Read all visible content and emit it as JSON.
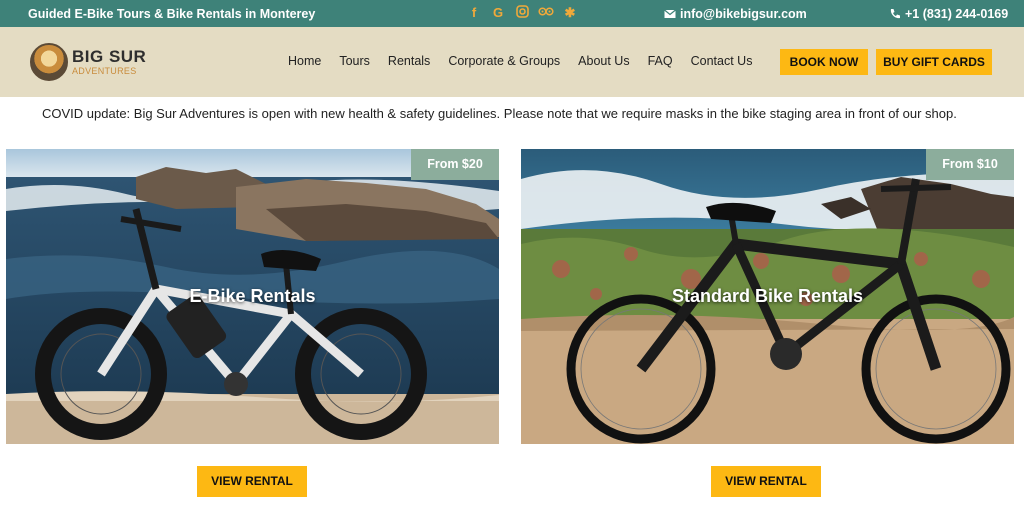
{
  "topbar": {
    "tagline": "Guided E-Bike Tours & Bike Rentals in Monterey",
    "email": "info@bikebigsur.com",
    "phone": "+1 (831) 244-0169",
    "social_icons": [
      "facebook-icon",
      "google-icon",
      "instagram-icon",
      "tripadvisor-icon",
      "yelp-icon"
    ]
  },
  "logo": {
    "line1": "BIG SUR",
    "line2": "ADVENTURES"
  },
  "nav": {
    "items": [
      "Home",
      "Tours",
      "Rentals",
      "Corporate & Groups",
      "About Us",
      "FAQ",
      "Contact Us"
    ],
    "book_now": "BOOK NOW",
    "gift_cards": "BUY GIFT CARDS"
  },
  "notice": "COVID update: Big Sur Adventures is open with new health & safety guidelines. Please note that we require masks in the bike staging area in front of our shop.",
  "cards": [
    {
      "title": "E-Bike Rentals",
      "price": "From $20",
      "button": "VIEW RENTAL"
    },
    {
      "title": "Standard Bike Rentals",
      "price": "From $10",
      "button": "VIEW RENTAL"
    }
  ],
  "colors": {
    "topbar_bg": "#3e8279",
    "header_bg": "#e4dcc3",
    "accent_yellow": "#fdb813",
    "badge_green": "#8cad9c",
    "social_orange": "#f0a93a"
  }
}
